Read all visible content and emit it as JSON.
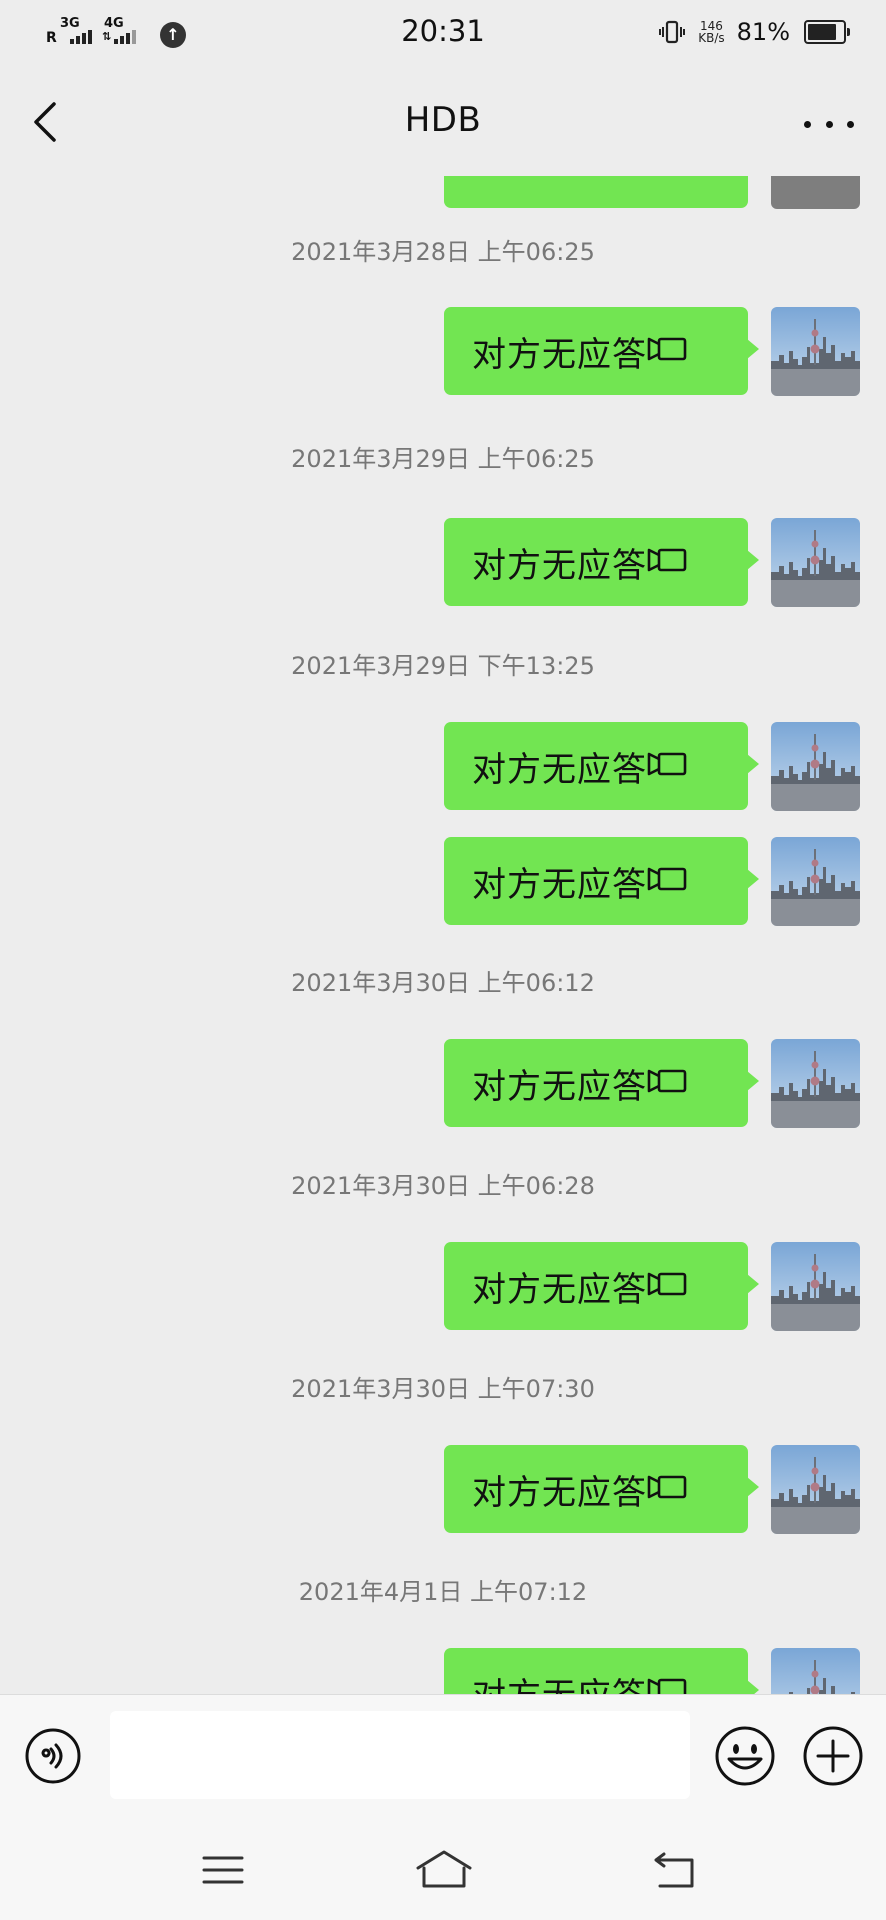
{
  "status_bar": {
    "network_1": "3G",
    "network_2": "4G",
    "roaming": "R",
    "time": "20:31",
    "speed_value": "146",
    "speed_unit": "KB/s",
    "battery_percent": "81%",
    "battery_level": 0.81
  },
  "header": {
    "title": "HDB",
    "back_icon": "chevron-left-icon",
    "more_icon": "more-dots-icon"
  },
  "messages": [
    {
      "timestamp": "2021年3月28日 上午06:25",
      "text": "对方无应答"
    },
    {
      "timestamp": "2021年3月29日 上午06:25",
      "text": "对方无应答"
    },
    {
      "timestamp": "2021年3月29日 下午13:25",
      "text": "对方无应答"
    },
    {
      "timestamp": "",
      "text": "对方无应答"
    },
    {
      "timestamp": "2021年3月30日 上午06:12",
      "text": "对方无应答"
    },
    {
      "timestamp": "2021年3月30日 上午06:28",
      "text": "对方无应答"
    },
    {
      "timestamp": "2021年3月30日 上午07:30",
      "text": "对方无应答"
    },
    {
      "timestamp": "2021年4月1日 上午07:12",
      "text": "对方无应答"
    }
  ],
  "input_bar": {
    "voice_icon": "voice-icon",
    "input_value": "",
    "emoji_icon": "emoji-icon",
    "plus_icon": "plus-icon"
  },
  "system_nav": {
    "icons": [
      "menu-icon",
      "home-icon",
      "back-icon"
    ]
  },
  "colors": {
    "background": "#ededed",
    "bubble": "#72e552",
    "timestamp_text": "#777777"
  }
}
